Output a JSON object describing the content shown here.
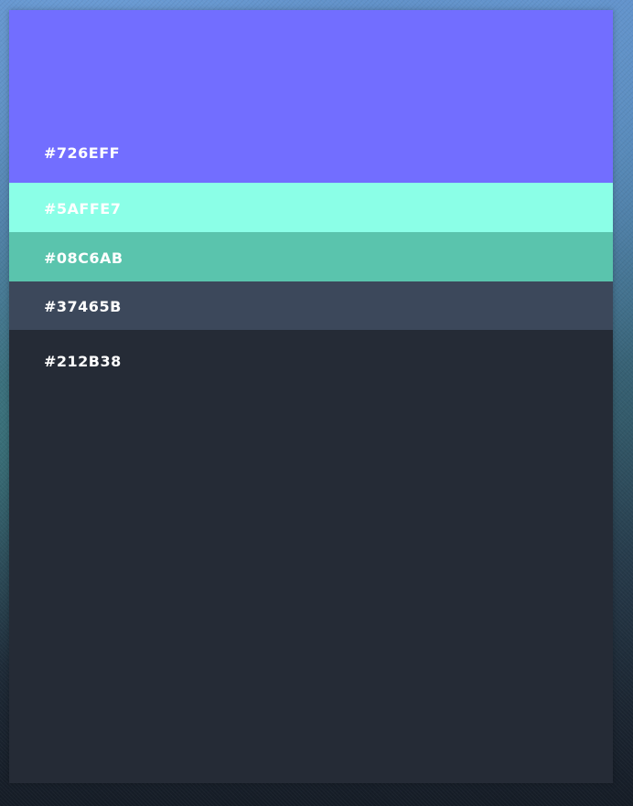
{
  "palette": {
    "swatches": [
      {
        "hex": "#726EFF",
        "label": "#726EFF"
      },
      {
        "hex": "#8BFFE7",
        "label": "#5AFFE7"
      },
      {
        "hex": "#5AC4AD",
        "label": "#08C6AB"
      },
      {
        "hex": "#3C485B",
        "label": "#37465B"
      },
      {
        "hex": "#252B36",
        "label": "#212B38"
      }
    ]
  },
  "colors": {
    "background_top": "#5f8fc6",
    "background_bottom": "#151c26",
    "label_text": "#ffffff"
  }
}
